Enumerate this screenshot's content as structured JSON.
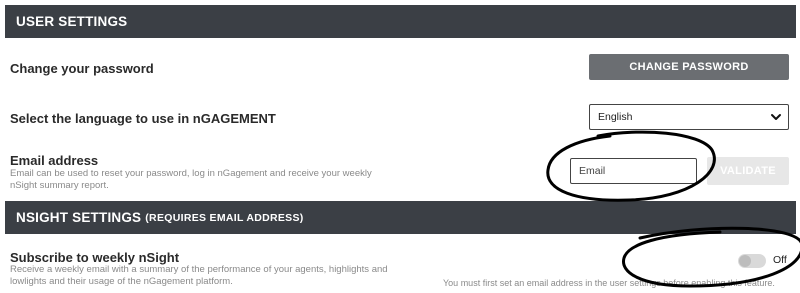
{
  "user_settings": {
    "title": "USER SETTINGS",
    "password": {
      "label": "Change your password",
      "button_label": "CHANGE PASSWORD"
    },
    "language": {
      "label": "Select the language to use in nGAGEMENT",
      "selected": "English"
    },
    "email": {
      "label": "Email address",
      "description": "Email can be used to reset your password, log in nGagement and receive your weekly nSight summary report.",
      "placeholder": "Email",
      "value": "",
      "validate_label": "VALIDATE"
    }
  },
  "nsight_settings": {
    "title": "NSIGHT SETTINGS",
    "title_suffix": "(REQUIRES EMAIL ADDRESS)",
    "subscribe": {
      "label": "Subscribe to weekly nSight",
      "description": "Receive a weekly email with a summary of the performance of your agents, highlights and lowlights and their usage of the nGagement platform.",
      "toggle_state": "Off",
      "hint": "You must first set an email address in the user settings before enabling this feature."
    }
  },
  "colors": {
    "header_bg": "#3b3f45",
    "button_bg": "#6b6e72",
    "annotation_ink": "#000000"
  }
}
